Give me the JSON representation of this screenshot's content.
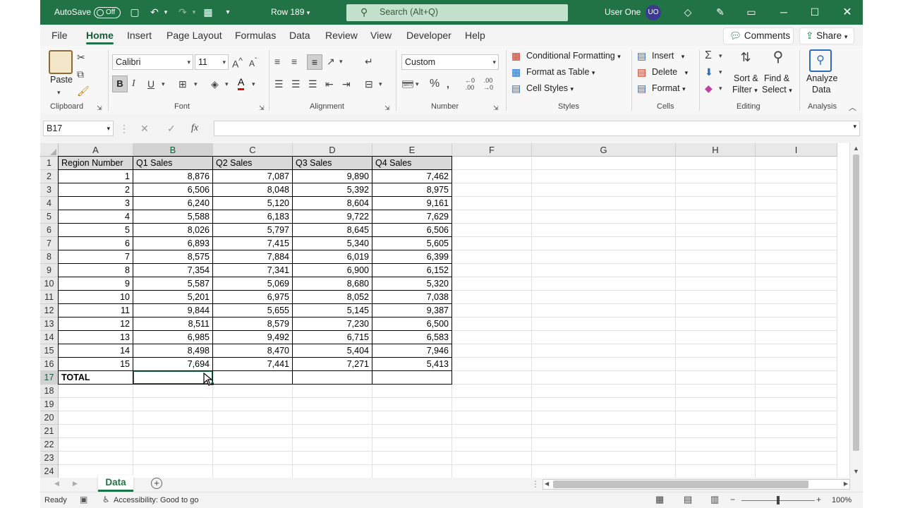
{
  "titlebar": {
    "autosave_label": "AutoSave",
    "autosave_state": "Off",
    "doc_name": "Row 189",
    "search_placeholder": "Search (Alt+Q)",
    "user_name": "User One",
    "user_initials": "UO"
  },
  "menu": {
    "items": [
      "File",
      "Home",
      "Insert",
      "Page Layout",
      "Formulas",
      "Data",
      "Review",
      "View",
      "Developer",
      "Help"
    ],
    "active": "Home",
    "comments": "Comments",
    "share": "Share"
  },
  "ribbon": {
    "clipboard": {
      "paste": "Paste",
      "label": "Clipboard"
    },
    "font": {
      "name": "Calibri",
      "size": "11",
      "label": "Font",
      "bold": "B",
      "italic": "I",
      "underline": "U"
    },
    "alignment": {
      "label": "Alignment"
    },
    "number": {
      "format": "Custom",
      "label": "Number"
    },
    "styles": {
      "conditional": "Conditional Formatting",
      "table": "Format as Table",
      "cell": "Cell Styles",
      "label": "Styles"
    },
    "cells": {
      "insert": "Insert",
      "delete": "Delete",
      "format": "Format",
      "label": "Cells"
    },
    "editing": {
      "sort1": "Sort &",
      "sort2": "Filter",
      "find1": "Find &",
      "find2": "Select",
      "label": "Editing"
    },
    "analysis": {
      "analyze1": "Analyze",
      "analyze2": "Data",
      "label": "Analysis"
    }
  },
  "formula_bar": {
    "name_box": "B17",
    "fx": "fx",
    "content": ""
  },
  "sheet": {
    "columns": [
      "A",
      "B",
      "C",
      "D",
      "E",
      "F",
      "G",
      "H",
      "I"
    ],
    "selected_column": "B",
    "selected_row": 17,
    "header_row": [
      "Region Number",
      "Q1 Sales",
      "Q2 Sales",
      "Q3 Sales",
      "Q4 Sales"
    ],
    "rows": [
      [
        "1",
        "8,876",
        "7,087",
        "9,890",
        "7,462"
      ],
      [
        "2",
        "6,506",
        "8,048",
        "5,392",
        "8,975"
      ],
      [
        "3",
        "6,240",
        "5,120",
        "8,604",
        "9,161"
      ],
      [
        "4",
        "5,588",
        "6,183",
        "9,722",
        "7,629"
      ],
      [
        "5",
        "8,026",
        "5,797",
        "8,645",
        "6,506"
      ],
      [
        "6",
        "6,893",
        "7,415",
        "5,340",
        "5,605"
      ],
      [
        "7",
        "8,575",
        "7,884",
        "6,019",
        "6,399"
      ],
      [
        "8",
        "7,354",
        "7,341",
        "6,900",
        "6,152"
      ],
      [
        "9",
        "5,587",
        "5,069",
        "8,680",
        "5,320"
      ],
      [
        "10",
        "5,201",
        "6,975",
        "8,052",
        "7,038"
      ],
      [
        "11",
        "9,844",
        "5,655",
        "5,145",
        "9,387"
      ],
      [
        "12",
        "8,511",
        "8,579",
        "7,230",
        "6,500"
      ],
      [
        "13",
        "6,985",
        "9,492",
        "6,715",
        "6,583"
      ],
      [
        "14",
        "8,498",
        "8,470",
        "5,404",
        "7,946"
      ],
      [
        "15",
        "7,694",
        "7,441",
        "7,271",
        "5,413"
      ]
    ],
    "total_label": "TOTAL",
    "row_numbers": [
      "1",
      "2",
      "3",
      "4",
      "5",
      "6",
      "7",
      "8",
      "9",
      "10",
      "11",
      "12",
      "13",
      "14",
      "15",
      "16",
      "17",
      "18",
      "19",
      "20",
      "21",
      "22",
      "23",
      "24"
    ]
  },
  "tabs": {
    "active": "Data"
  },
  "status": {
    "ready": "Ready",
    "accessibility": "Accessibility: Good to go",
    "zoom": "100%"
  }
}
